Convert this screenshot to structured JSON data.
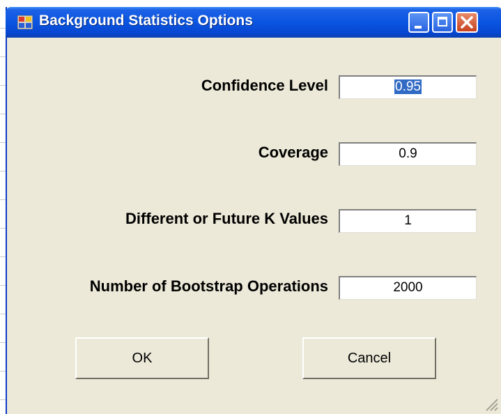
{
  "window": {
    "title": "Background Statistics Options"
  },
  "form": {
    "fields": [
      {
        "label": "Confidence Level",
        "value": "0.95"
      },
      {
        "label": "Coverage",
        "value": "0.9"
      },
      {
        "label": "Different or Future K Values",
        "value": "1"
      },
      {
        "label": "Number of Bootstrap Operations",
        "value": "2000"
      }
    ]
  },
  "buttons": {
    "ok_label": "OK",
    "cancel_label": "Cancel"
  },
  "icons": {
    "app": "app-window-icon",
    "minimize": "minimize-icon",
    "maximize": "maximize-icon",
    "close": "close-icon",
    "resize": "resize-grip-icon"
  },
  "colors": {
    "titlebar": "#0a55e1",
    "dialog_bg": "#ece9d8",
    "close_button": "#c8431f",
    "selection": "#316ac5"
  }
}
